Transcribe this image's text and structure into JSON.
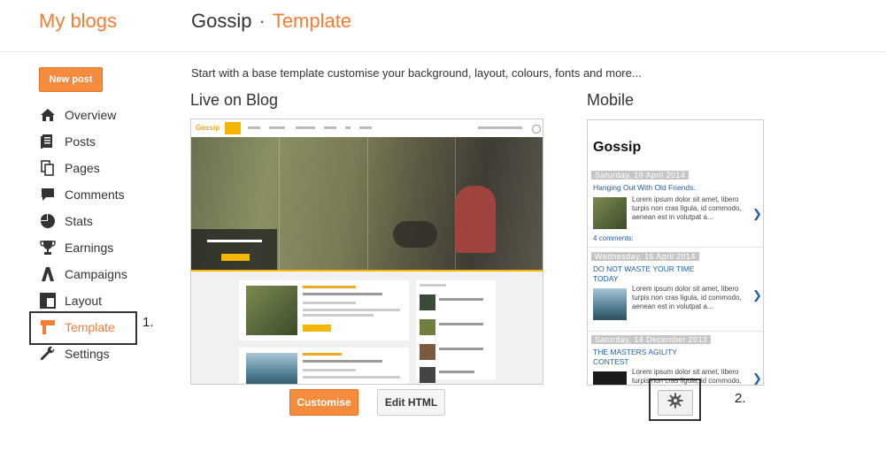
{
  "header": {
    "brand": "My blogs",
    "blog_name": "Gossip",
    "separator": "·",
    "current_page": "Template"
  },
  "sidebar": {
    "new_post": "New post",
    "items": [
      {
        "label": "Overview",
        "icon": "home-icon"
      },
      {
        "label": "Posts",
        "icon": "posts-icon"
      },
      {
        "label": "Pages",
        "icon": "pages-icon"
      },
      {
        "label": "Comments",
        "icon": "comments-icon"
      },
      {
        "label": "Stats",
        "icon": "stats-icon"
      },
      {
        "label": "Earnings",
        "icon": "trophy-icon"
      },
      {
        "label": "Campaigns",
        "icon": "campaigns-icon"
      },
      {
        "label": "Layout",
        "icon": "layout-icon"
      },
      {
        "label": "Template",
        "icon": "template-icon",
        "active": true
      },
      {
        "label": "Settings",
        "icon": "wrench-icon"
      }
    ]
  },
  "annotations": {
    "label1": "1.",
    "label2": "2."
  },
  "main": {
    "intro": "Start with a base template customise your background, layout, colours, fonts and more...",
    "live_title": "Live on Blog",
    "mobile_title": "Mobile",
    "customise_button": "Customise",
    "edit_html_button": "Edit HTML"
  },
  "mobile_preview": {
    "blog_title": "Gossip",
    "posts": [
      {
        "date": "Saturday, 19 April 2014",
        "title": "Hanging Out With Old Friends.",
        "excerpt": "Lorem ipsum dolor sit amet, libero turpis non cras ligula, id commodo, aenean est in volutpat a...",
        "comments": "4 comments:"
      },
      {
        "date": "Wednesday, 16 April 2014",
        "title": "DO NOT WASTE YOUR TIME TODAY",
        "excerpt": "Lorem ipsum dolor sit amet, libero turpis non cras ligula, id commodo, aenean est in volutpat a..."
      },
      {
        "date": "Saturday, 14 December 2013",
        "title": "THE MASTERS AGILITY CONTEST",
        "excerpt": "Lorem ipsum dolor sit amet, libero turpis non cras ligula, id commodo, aenean est in volutpat a..."
      }
    ]
  },
  "desktop_preview": {
    "logo": "Gossip"
  },
  "colors": {
    "accent": "#f57d33",
    "link": "#1f5ea8"
  }
}
